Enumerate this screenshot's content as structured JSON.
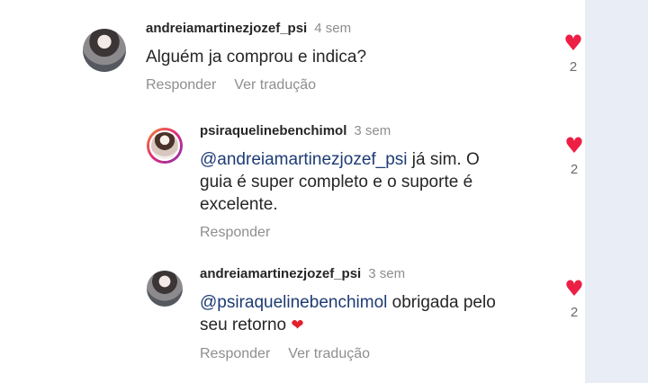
{
  "comments": [
    {
      "username": "andreiamartinezjozef_psi",
      "time": "4 sem",
      "text": "Alguém ja comprou e indica?",
      "reply_label": "Responder",
      "translate_label": "Ver tradução",
      "likes": "2"
    },
    {
      "username": "psiraquelinebenchimol",
      "time": "3 sem",
      "mention": "@andreiamartinezjozef_psi",
      "text": " já sim. O guia é super completo e o suporte é excelente.",
      "reply_label": "Responder",
      "likes": "2"
    },
    {
      "username": "andreiamartinezjozef_psi",
      "time": "3 sem",
      "mention": "@psiraquelinebenchimol",
      "text": " obrigada pelo seu retorno ",
      "emoji": "❤",
      "reply_label": "Responder",
      "translate_label": "Ver tradução",
      "likes": "2"
    }
  ]
}
